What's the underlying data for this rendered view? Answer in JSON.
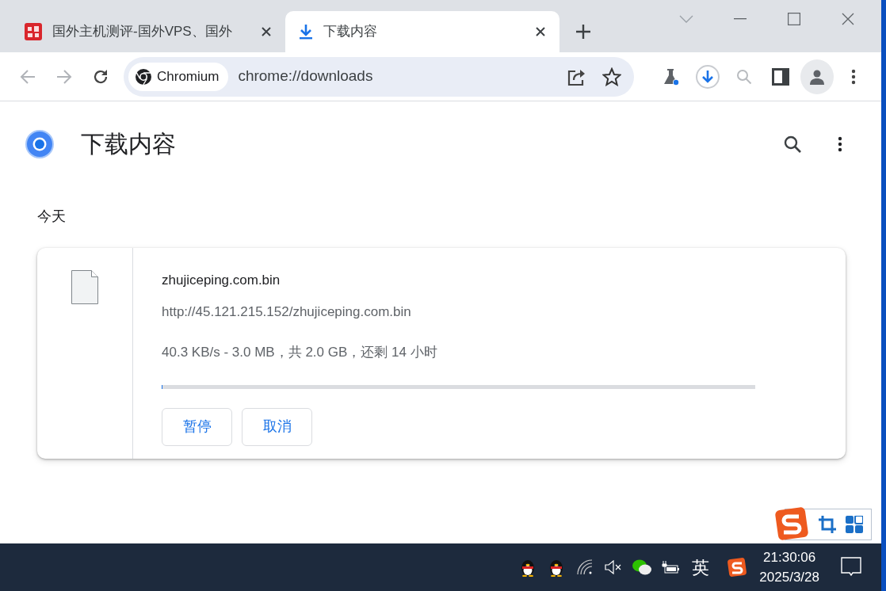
{
  "tabs": [
    {
      "title": "国外主机测评-国外VPS、国外",
      "selected": false
    },
    {
      "title": "下载内容",
      "selected": true
    }
  ],
  "toolbar": {
    "site_chip": "Chromium",
    "url": "chrome://downloads"
  },
  "page": {
    "title": "下载内容",
    "section": "今天",
    "downloads": [
      {
        "filename": "zhujiceping.com.bin",
        "url": "http://45.121.215.152/zhujiceping.com.bin",
        "status": "40.3 KB/s - 3.0 MB，共 2.0 GB，还剩 14 小时",
        "level": 0.0015,
        "buttons": [
          "暂停",
          "取消"
        ]
      }
    ]
  },
  "taskbar": {
    "input_mode": "英",
    "time": "21:30:06",
    "date": "2025/3/28"
  }
}
